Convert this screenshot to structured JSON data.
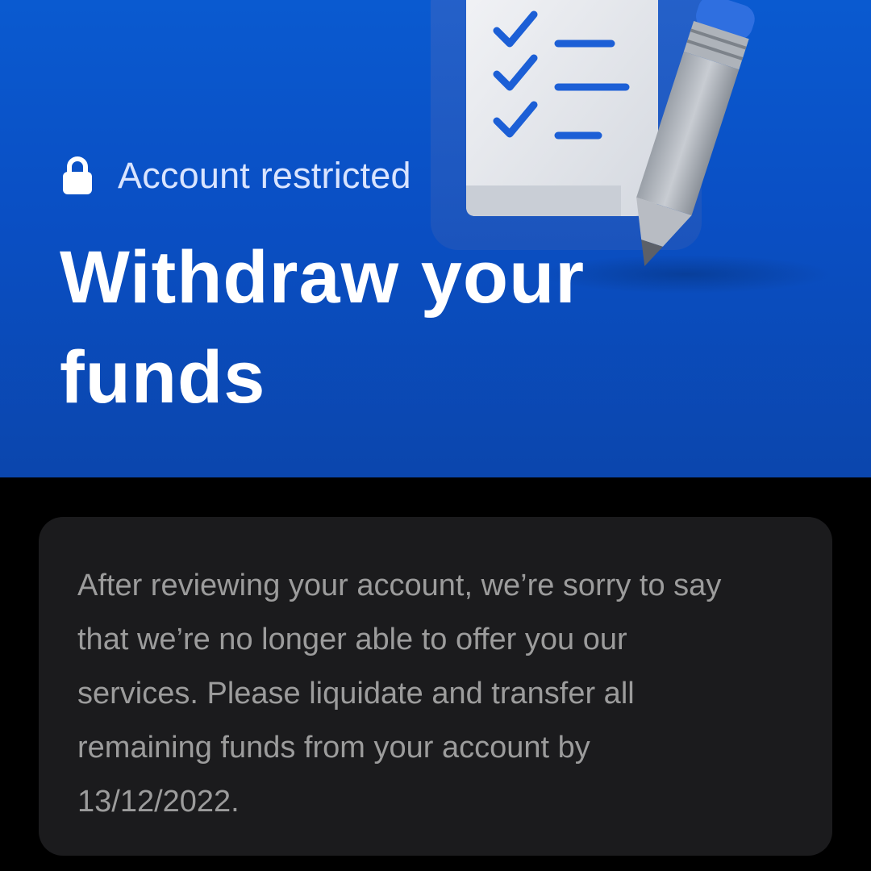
{
  "hero": {
    "status_icon": "lock-icon",
    "status_text": "Account restricted",
    "title": "Withdraw your funds",
    "illustration": "checklist-clipboard-with-pencil",
    "colors": {
      "background": "#0a4fc4",
      "status_text": "#d9e4ff",
      "title": "#ffffff",
      "check": "#1c5fd6"
    }
  },
  "notice": {
    "message": "After reviewing your account, we’re sorry to say that we’re no longer able to offer you our services. Please liquidate and transfer all remaining funds from your account by 13/12/2022.",
    "colors": {
      "card_background": "#1b1b1d",
      "text": "#9c9c9c"
    }
  }
}
